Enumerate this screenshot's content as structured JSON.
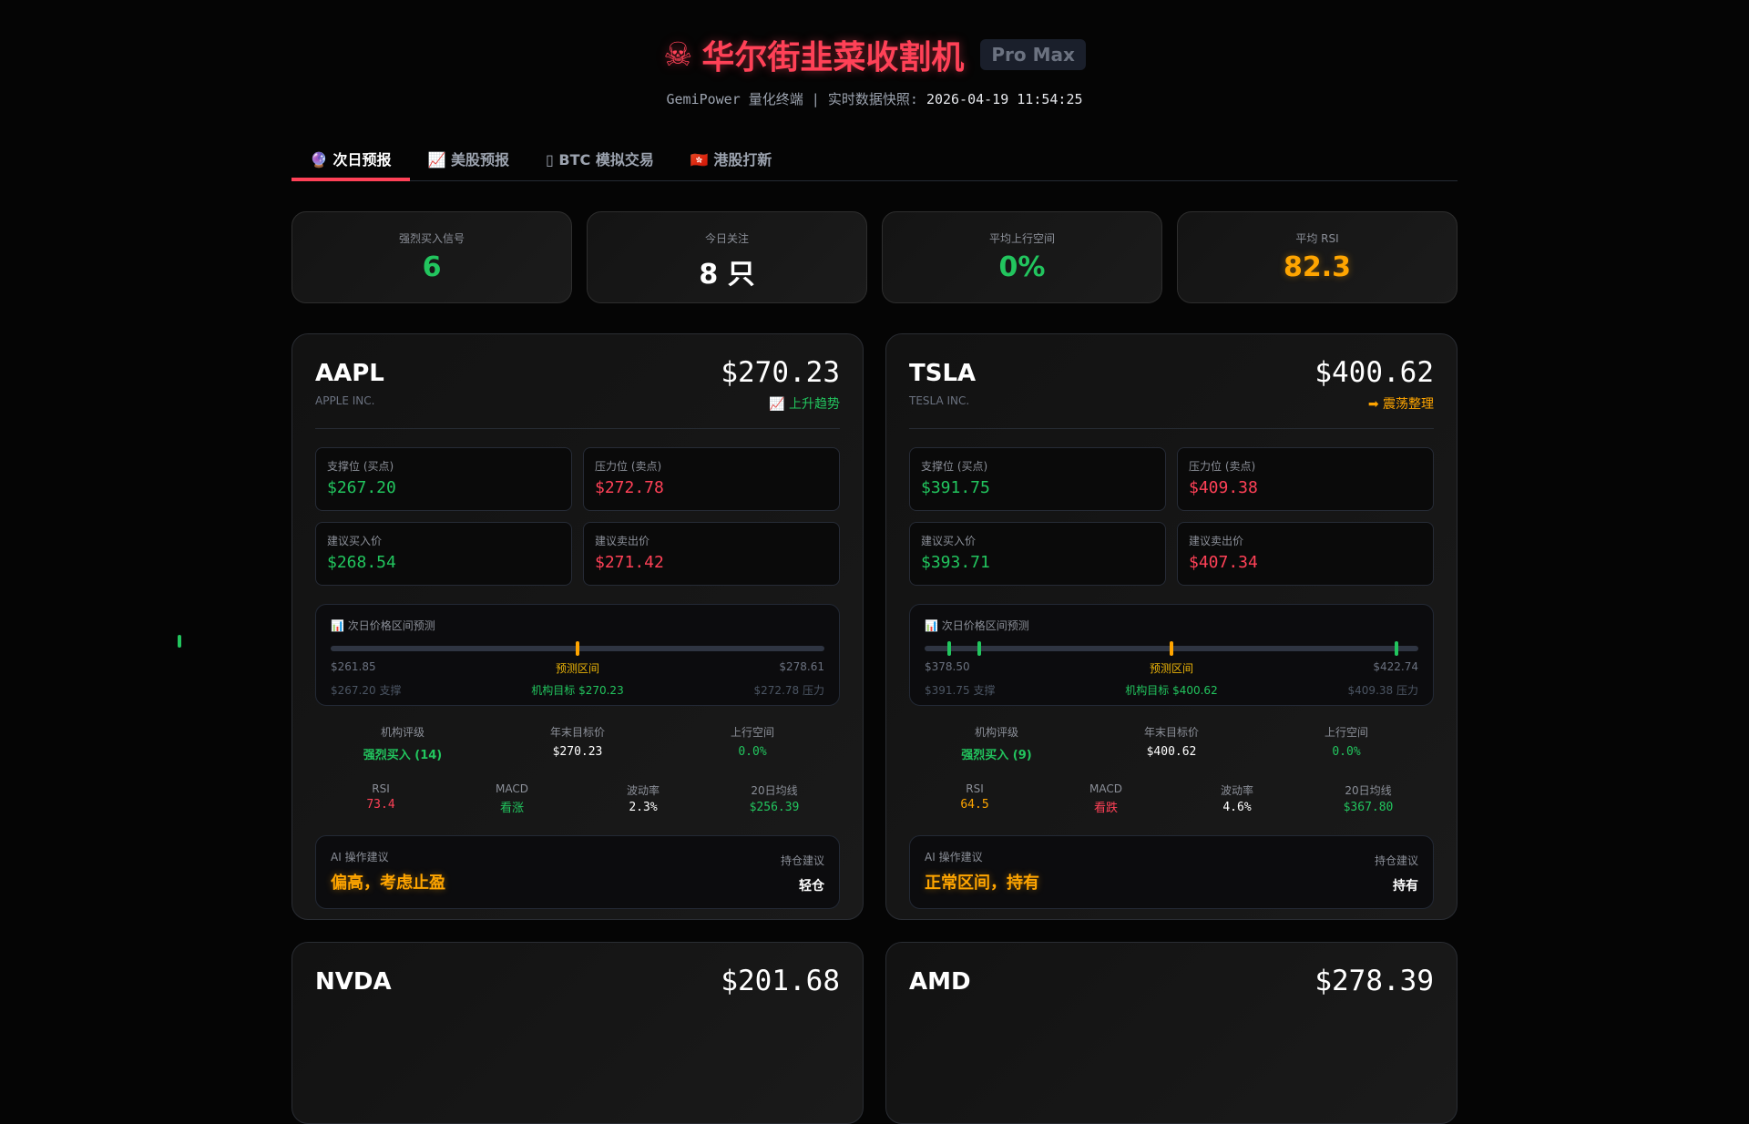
{
  "header": {
    "icon": "skull-crossbones-icon",
    "title": "华尔街韭菜收割机",
    "badge": "Pro Max",
    "subtitle_prefix": "GemiPower 量化终端 | 实时数据快照: ",
    "timestamp": "2026-04-19 11:54:25"
  },
  "tabs": [
    {
      "icon": "🔮",
      "label": "次日预报"
    },
    {
      "icon": "📈",
      "label": "美股预报"
    },
    {
      "icon": "▯",
      "label": "BTC 模拟交易"
    },
    {
      "icon": "🇭🇰",
      "label": "港股打新"
    }
  ],
  "stats": [
    {
      "label": "强烈买入信号",
      "value": "6"
    },
    {
      "label": "今日关注",
      "value": "8 只"
    },
    {
      "label": "平均上行空间",
      "value": "0%"
    },
    {
      "label": "平均 RSI",
      "value": "82.3"
    }
  ],
  "labels": {
    "support": "支撑位 (买点)",
    "resistance": "压力位 (卖点)",
    "buy": "建议买入价",
    "sell": "建议卖出价",
    "range_title": "📊 次日价格区间预测",
    "range_mid": "预测区间",
    "rating": "机构评级",
    "target": "年末目标价",
    "upside": "上行空间",
    "rsi": "RSI",
    "macd": "MACD",
    "vol": "波动率",
    "ma20": "20日均线",
    "ai": "AI 操作建议",
    "hold": "持仓建议"
  },
  "cards": [
    {
      "ticker": "AAPL",
      "name": "APPLE INC.",
      "price": "$270.23",
      "trend": "📈 上升趋势",
      "support": "$267.20",
      "resistance": "$272.78",
      "buy": "$268.54",
      "sell": "$271.42",
      "range_low": "$261.85",
      "range_high": "$278.61",
      "support_note": "$267.20 支撑",
      "target_note": "机构目标 $270.23",
      "resistance_note": "$272.78 压力",
      "markers": [
        {
          "pos": 0.5,
          "color": "#ffa500"
        }
      ],
      "rating": "强烈买入 (14)",
      "target": "$270.23",
      "upside": "0.0%",
      "rsi": "73.4",
      "macd": "看涨",
      "vol": "2.3%",
      "ma20": "$256.39",
      "advice": "偏高，考虑止盈",
      "hold": "轻仓"
    },
    {
      "ticker": "TSLA",
      "name": "TESLA INC.",
      "price": "$400.62",
      "trend": "➡ 震荡整理",
      "support": "$391.75",
      "resistance": "$409.38",
      "buy": "$393.71",
      "sell": "$407.34",
      "range_low": "$378.50",
      "range_high": "$422.74",
      "support_note": "$391.75 支撑",
      "target_note": "机构目标 $400.62",
      "resistance_note": "$409.38 压力",
      "markers": [
        {
          "pos": 0.05,
          "color": "#22c55e"
        },
        {
          "pos": 0.11,
          "color": "#22c55e"
        },
        {
          "pos": 0.5,
          "color": "#ffa500"
        },
        {
          "pos": 0.955,
          "color": "#22c55e"
        }
      ],
      "rating": "强烈买入 (9)",
      "target": "$400.62",
      "upside": "0.0%",
      "rsi": "64.5",
      "macd": "看跌",
      "vol": "4.6%",
      "ma20": "$367.80",
      "advice": "正常区间，持有",
      "hold": "持有"
    },
    {
      "ticker": "NVDA",
      "price": "$201.68"
    },
    {
      "ticker": "AMD",
      "price": "$278.39"
    }
  ]
}
